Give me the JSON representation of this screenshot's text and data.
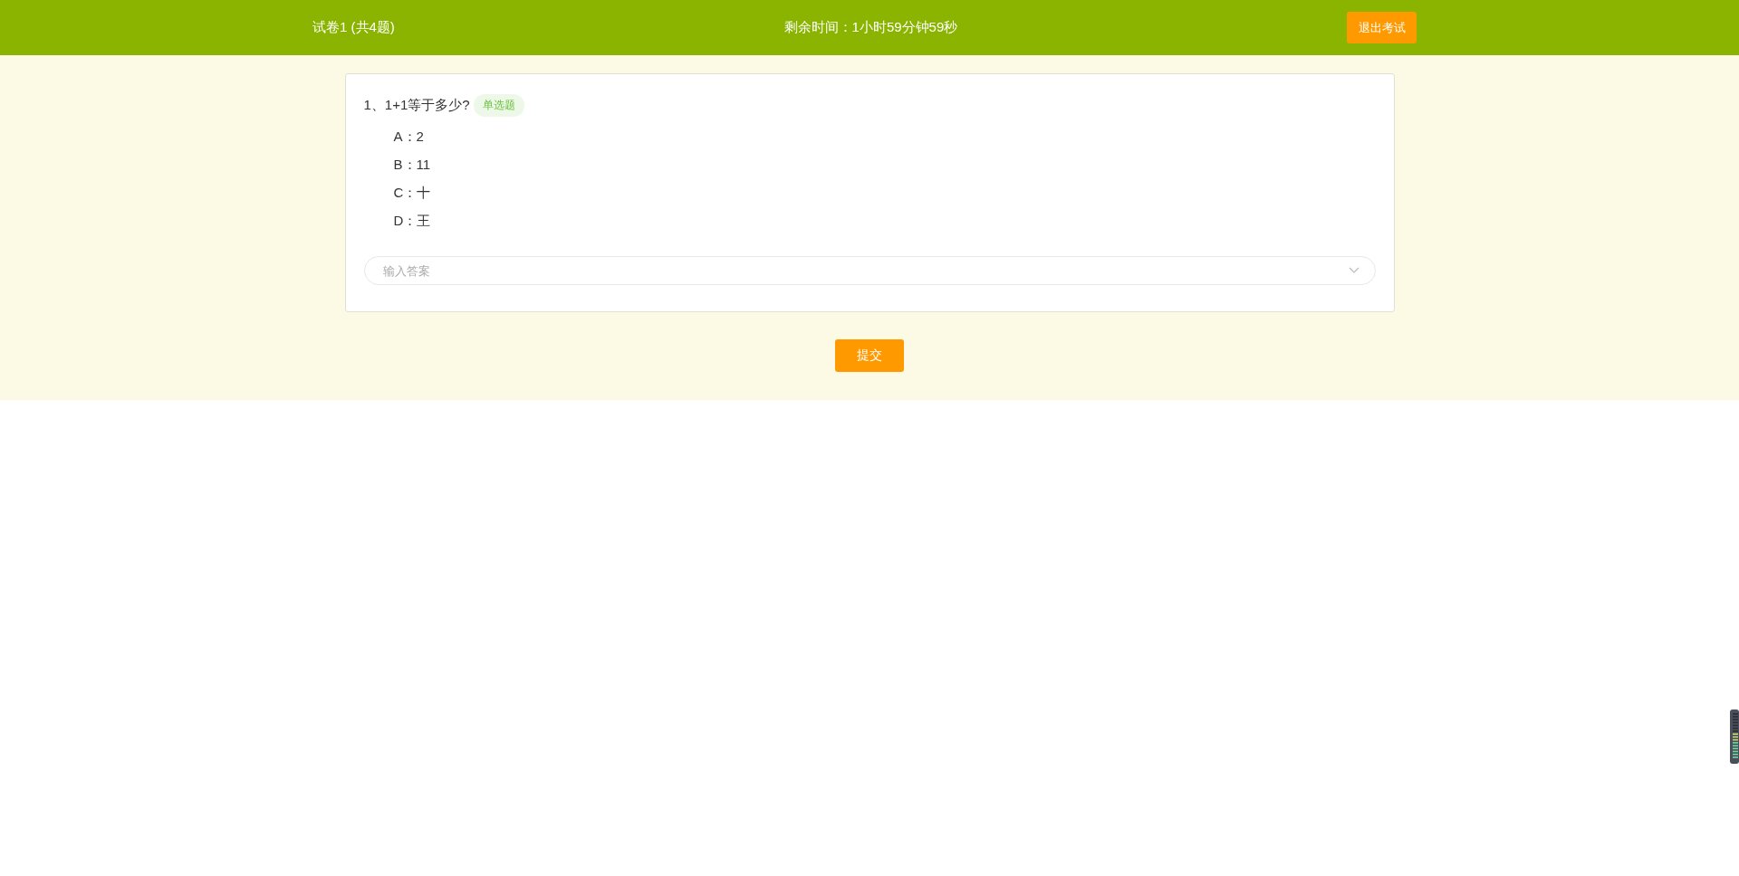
{
  "header": {
    "title": "试卷1 (共4题)",
    "timer": "剩余时间：1小时59分钟59秒",
    "exit_button": "退出考试"
  },
  "question": {
    "text": "1、1+1等于多少?",
    "tag": "单选题",
    "options": [
      {
        "label": "A：2"
      },
      {
        "label": "B：11"
      },
      {
        "label": "C：十"
      },
      {
        "label": "D：王"
      }
    ],
    "answer": {
      "placeholder": "输入答案"
    }
  },
  "submit_button": "提交"
}
